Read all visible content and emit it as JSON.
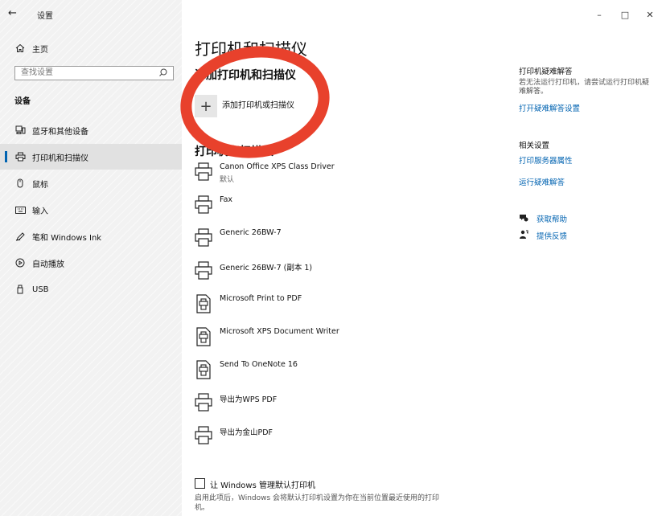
{
  "titlebar": {
    "title": "设置",
    "back_glyph": "←",
    "minimize_glyph": "–",
    "maximize_glyph": "□",
    "close_glyph": "✕"
  },
  "sidebar": {
    "home_label": "主页",
    "search_placeholder": "查找设置",
    "section_label": "设备",
    "items": [
      {
        "label": "蓝牙和其他设备",
        "icon": "bluetooth-devices-icon"
      },
      {
        "label": "打印机和扫描仪",
        "icon": "printer-icon",
        "selected": true
      },
      {
        "label": "鼠标",
        "icon": "mouse-icon"
      },
      {
        "label": "输入",
        "icon": "keyboard-icon"
      },
      {
        "label": "笔和 Windows Ink",
        "icon": "pen-icon"
      },
      {
        "label": "自动播放",
        "icon": "autoplay-icon"
      },
      {
        "label": "USB",
        "icon": "usb-icon"
      }
    ]
  },
  "main": {
    "title": "打印机和扫描仪",
    "add_heading": "添加打印机和扫描仪",
    "add_label": "添加打印机或扫描仪",
    "add_glyph": "+",
    "list_heading": "打印机和扫描仪",
    "printers": [
      {
        "name": "Canon Office XPS Class Driver",
        "sub": "默认",
        "icon": "printer-icon"
      },
      {
        "name": "Fax",
        "sub": "",
        "icon": "printer-icon"
      },
      {
        "name": "Generic 26BW-7",
        "sub": "",
        "icon": "printer-icon"
      },
      {
        "name": "Generic 26BW-7 (副本 1)",
        "sub": "",
        "icon": "printer-icon"
      },
      {
        "name": "Microsoft Print to PDF",
        "sub": "",
        "icon": "document-printer-icon"
      },
      {
        "name": "Microsoft XPS Document Writer",
        "sub": "",
        "icon": "document-printer-icon"
      },
      {
        "name": "Send To OneNote 16",
        "sub": "",
        "icon": "document-printer-icon"
      },
      {
        "name": "导出为WPS PDF",
        "sub": "",
        "icon": "printer-icon"
      },
      {
        "name": "导出为金山PDF",
        "sub": "",
        "icon": "printer-icon"
      }
    ],
    "manage_checkbox_label": "让 Windows 管理默认打印机",
    "manage_checkbox_checked": false,
    "manage_desc": "启用此项后，Windows 会将默认打印机设置为你在当前位置最近使用的打印机。"
  },
  "right_pane": {
    "troubleshoot_heading": "打印机疑难解答",
    "troubleshoot_text": "若无法运行打印机，请尝试运行打印机疑难解答。",
    "troubleshoot_link": "打开疑难解答设置",
    "related_heading": "相关设置",
    "related_links": [
      "打印服务器属性",
      "运行疑难解答"
    ],
    "help_items": [
      {
        "label": "获取帮助",
        "icon": "help-chat-icon"
      },
      {
        "label": "提供反馈",
        "icon": "feedback-icon"
      }
    ]
  },
  "colors": {
    "accent": "#0063b1",
    "annotation": "#e8412c",
    "sidebar_bg": "#f2f2f2"
  }
}
